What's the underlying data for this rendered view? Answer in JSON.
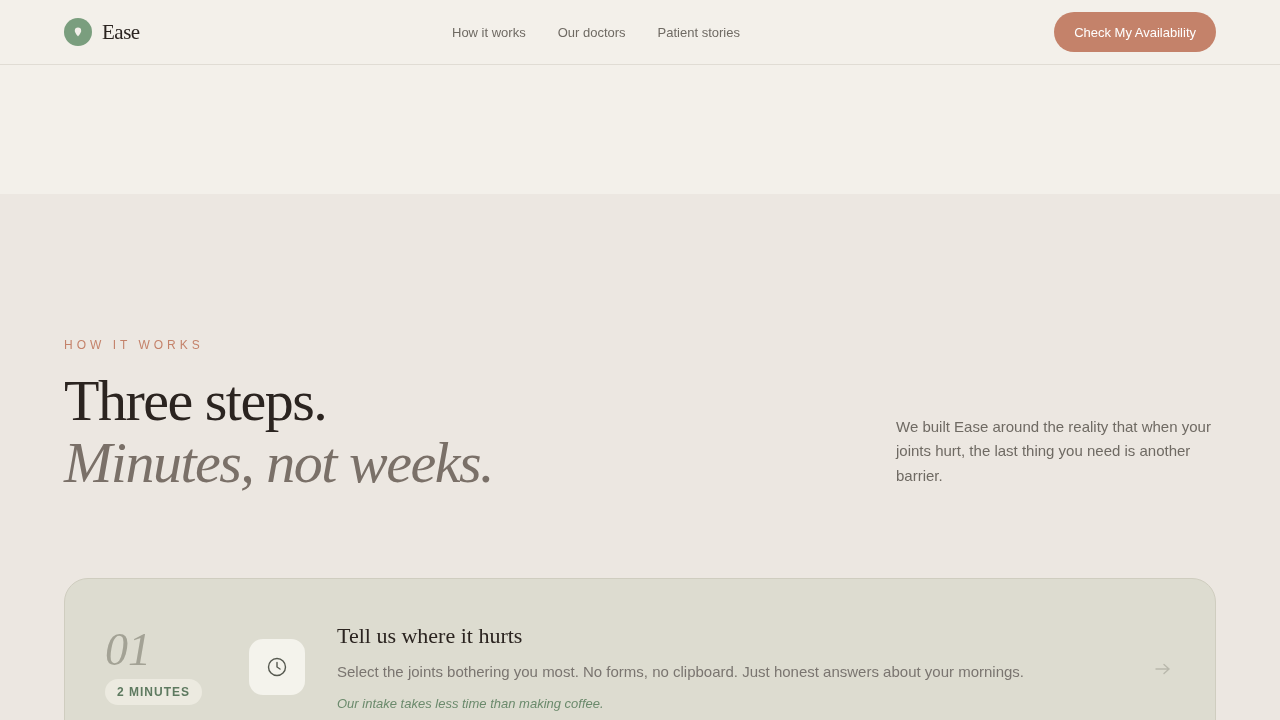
{
  "brand": {
    "name": "Ease"
  },
  "nav": [
    {
      "label": "How it works"
    },
    {
      "label": "Our doctors"
    },
    {
      "label": "Patient stories"
    }
  ],
  "cta": {
    "label": "Check My Availability"
  },
  "section": {
    "eyebrow": "HOW IT WORKS",
    "title": "Three steps.",
    "subtitle": "Minutes, not weeks.",
    "intro": "We built Ease around the reality that when your joints hurt, the last thing you need is another barrier."
  },
  "steps": [
    {
      "number": "01",
      "duration": "2 MINUTES",
      "title": "Tell us where it hurts",
      "text": "Select the joints bothering you most. No forms, no clipboard. Just honest answers about your mornings.",
      "note": "Our intake takes less time than making coffee."
    }
  ]
}
